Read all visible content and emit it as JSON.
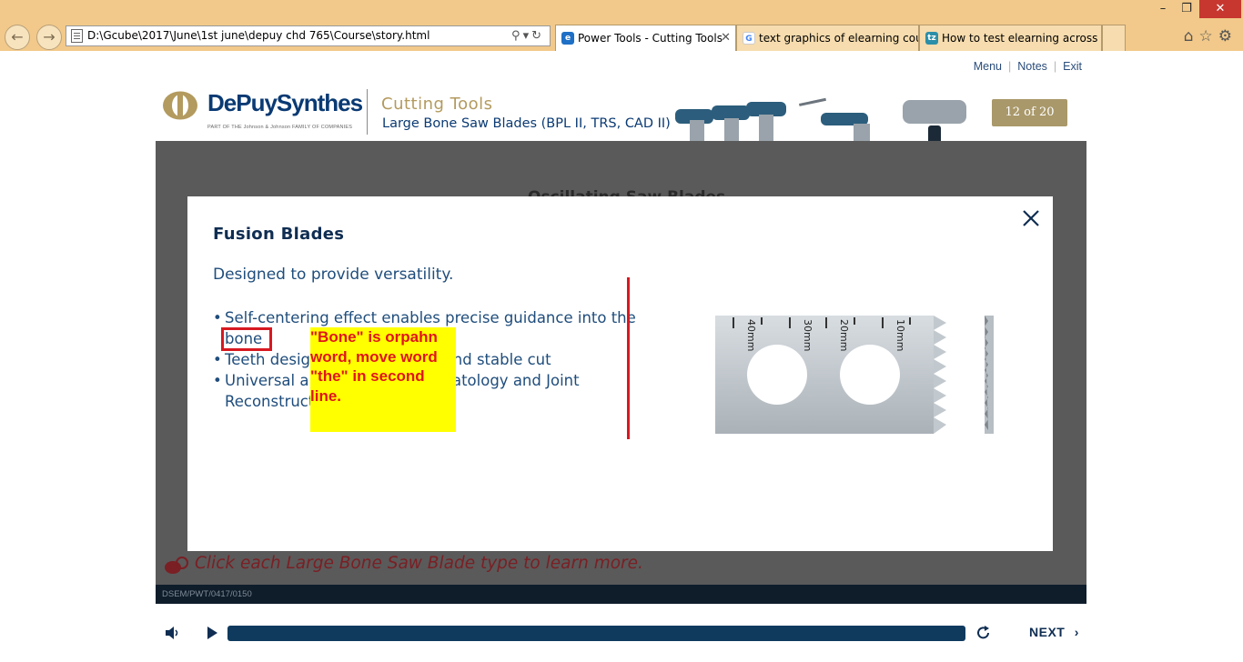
{
  "browser": {
    "address": "D:\\Gcube\\2017\\June\\1st june\\depuy chd 765\\Course\\story.html",
    "tabs": [
      {
        "label": "Power Tools - Cutting Tools",
        "active": true,
        "icon": "ie-page-icon"
      },
      {
        "label": "text graphics of elearning cour...",
        "active": false,
        "icon": "google-icon"
      },
      {
        "label": "How to test elearning across m...",
        "active": false,
        "icon": "tz-icon"
      }
    ],
    "window_controls": {
      "minimize": "–",
      "restore": "❐",
      "close": "✕"
    }
  },
  "course": {
    "top_links": {
      "menu": "Menu",
      "notes": "Notes",
      "exit": "Exit"
    },
    "brand": "DePuySynthes",
    "brand_sub": "PART OF THE Johnson & Johnson FAMILY OF COMPANIES",
    "section_title": "Cutting Tools",
    "section_subtitle": "Large Bone Saw Blades (BPL II, TRS, CAD II)",
    "page_counter": "12 of 20",
    "stage_heading": "Oscillating Saw Blades",
    "instruction": "Click each Large Bone Saw Blade type to learn more.",
    "footer_code": "DSEM/PWT/0417/0150"
  },
  "modal": {
    "title": "Fusion Blades",
    "intro": "Designed to provide versatility.",
    "bullets": [
      {
        "line1": "Self-centering effect enables precise guidance into the",
        "line2": "bone"
      },
      {
        "line1": "Teeth designed for a smooth and stable cut"
      },
      {
        "line1": "Universal application in Traumatology and Joint",
        "line2": "Reconstruction"
      }
    ],
    "annotation": "\"Bone\" is orpahn word, move word \"the\" in second line.",
    "blade_marks": [
      "40mm",
      "30mm",
      "20mm",
      "10mm"
    ]
  },
  "player": {
    "next_label": "NEXT",
    "progress": 1.0
  },
  "colors": {
    "brand_blue": "#0a3a73",
    "gold": "#a9986a",
    "annotation_red": "#d71920",
    "annotation_yellow": "#ffff00"
  }
}
